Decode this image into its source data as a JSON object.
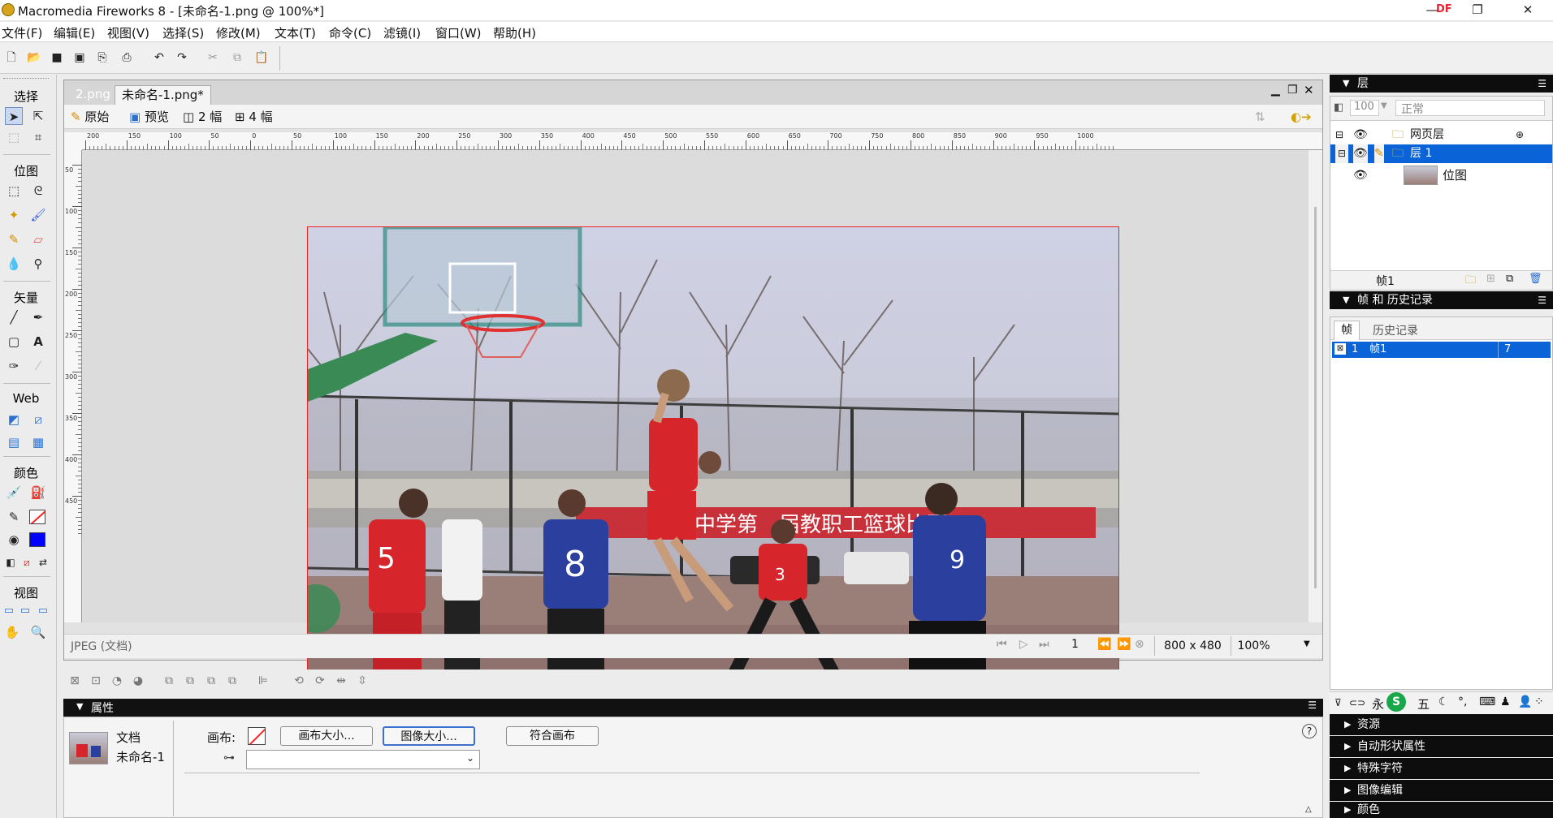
{
  "window": {
    "title": "Macromedia Fireworks 8 - [未命名-1.png @ 100%*]",
    "min_label": "—",
    "max_label": "❐",
    "close_label": "✕"
  },
  "menu": [
    "文件(F)",
    "编辑(E)",
    "视图(V)",
    "选择(S)",
    "修改(M)",
    "文本(T)",
    "命令(C)",
    "滤镜(I)",
    "窗口(W)",
    "帮助(H)"
  ],
  "tools": {
    "sections": [
      "选择",
      "位图",
      "矢量",
      "Web",
      "颜色",
      "视图"
    ]
  },
  "document": {
    "tabs": [
      "2.png",
      "未命名-1.png*"
    ],
    "view_buttons": [
      "原始",
      "预览",
      "2 幅",
      "4 幅"
    ],
    "ruler_h": [
      "200",
      "150",
      "100",
      "50",
      "0",
      "50",
      "100",
      "150",
      "200",
      "250",
      "300",
      "350",
      "400",
      "450",
      "500",
      "550",
      "600",
      "650",
      "700",
      "750",
      "800",
      "850",
      "900",
      "950",
      "1000"
    ],
    "ruler_v": [
      "50",
      "100",
      "150",
      "200",
      "250",
      "300",
      "350",
      "400",
      "450"
    ],
    "status_left": "JPEG (文档)",
    "frame_number": "1",
    "canvas_size": "800 x 480",
    "zoom": "100%"
  },
  "properties": {
    "panel_title": "属性",
    "doc_type": "文档",
    "doc_name": "未命名-1",
    "canvas_label": "画布:",
    "canvas_size_button": "画布大小...",
    "image_size_button": "图像大小...",
    "fit_canvas_button": "符合画布",
    "help": "?"
  },
  "layers_panel": {
    "title": "层",
    "opacity": "100",
    "blend_mode": "正常",
    "rows": [
      {
        "name": "网页层",
        "selected": false
      },
      {
        "name": "层 1",
        "selected": true
      },
      {
        "name": "位图",
        "selected": false
      }
    ],
    "footer_label": "帧1"
  },
  "frames_panel": {
    "title": "帧 和 历史记录",
    "tabs": [
      "帧",
      "历史记录"
    ],
    "row_index": "1",
    "row_name": "帧1",
    "row_delay": "7"
  },
  "ime": [
    "永",
    "五"
  ],
  "collapsed_panels": [
    "资源",
    "自动形状属性",
    "特殊字符",
    "图像编辑",
    "颜色"
  ],
  "colors": {
    "selection": "#0a64d8",
    "stroke_swatch": "#ff2020",
    "fill_swatch": "#0000ff",
    "jersey_red": "#d6262c",
    "jersey_blue": "#2a3f9e"
  }
}
